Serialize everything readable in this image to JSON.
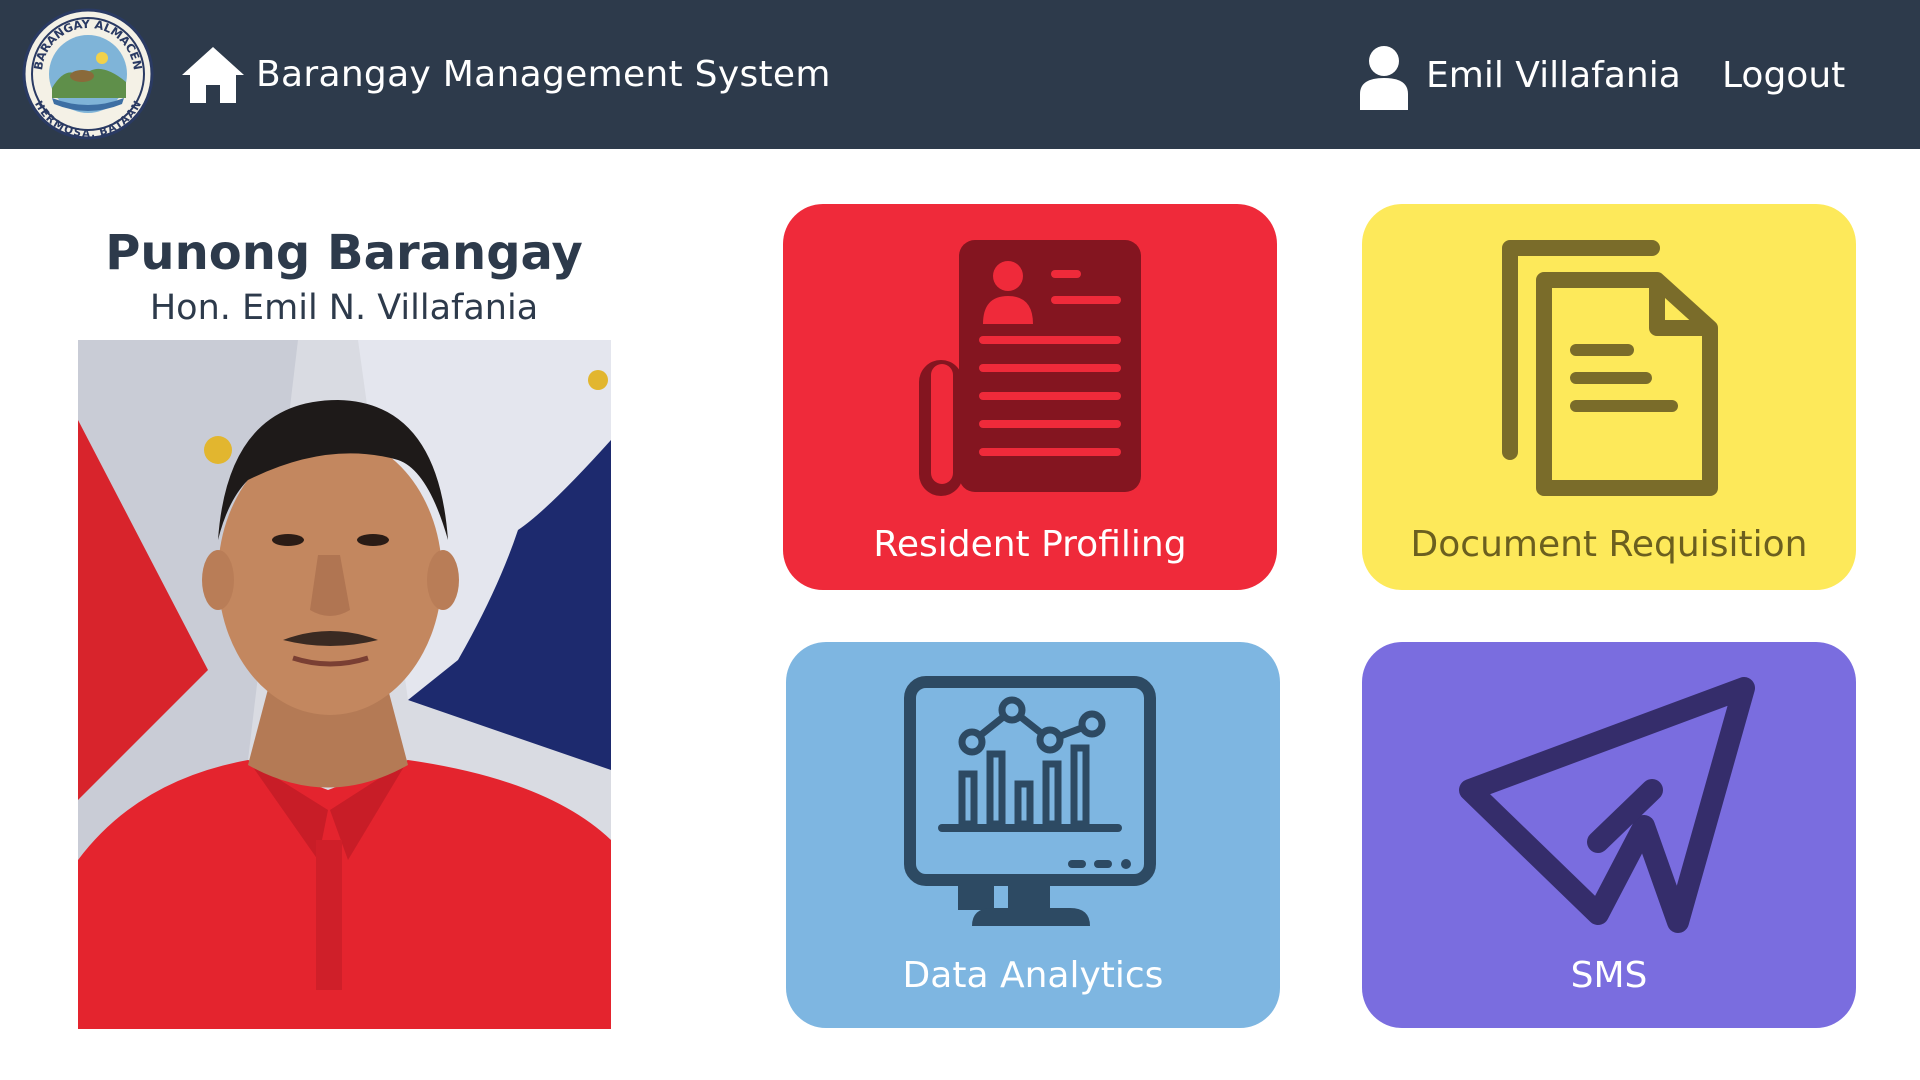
{
  "header": {
    "seal": {
      "icon": "barangay-seal-logo",
      "text_top": "BARANGAY ALMACEN",
      "text_bottom": "HERMOSA, BATAAN"
    },
    "home_icon": "home-icon",
    "title": "Barangay Management System",
    "user_icon": "user-icon",
    "user_name": "Emil Villafania",
    "logout_label": "Logout",
    "background": "#2d3a4b"
  },
  "profile": {
    "role": "Punong Barangay",
    "name": "Hon. Emil N. Villafania",
    "photo": "official-portrait"
  },
  "tiles": [
    {
      "label": "Resident Profiling",
      "icon": "resident-profile-document-icon",
      "color": "#ef2a3a"
    },
    {
      "label": "Document Requisition",
      "icon": "documents-icon",
      "color": "#fde95a"
    },
    {
      "label": "Data Analytics",
      "icon": "analytics-monitor-icon",
      "color": "#7eb6e1"
    },
    {
      "label": "SMS",
      "icon": "paper-plane-icon",
      "color": "#7a6ddf"
    }
  ]
}
